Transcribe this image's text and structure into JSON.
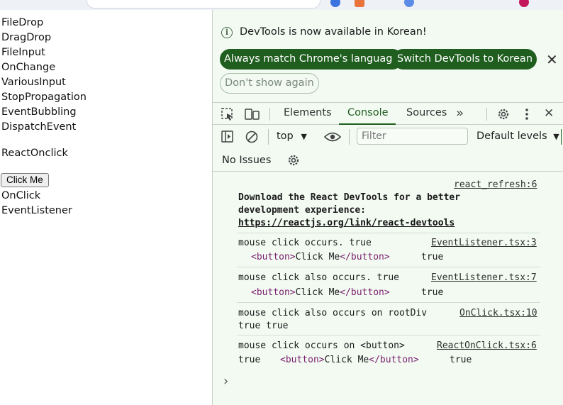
{
  "page": {
    "nav_links": [
      "FileDrop",
      "DragDrop",
      "FileInput",
      "OnChange",
      "VariousInput",
      "StopPropagation",
      "EventBubbling",
      "DispatchEvent"
    ],
    "section_title": "ReactOnclick",
    "button_label": "Click Me",
    "below_button": [
      "OnClick",
      "EventListener"
    ]
  },
  "devtools": {
    "banner": {
      "text": "DevTools is now available in Korean!",
      "always_match": "Always match Chrome's language",
      "switch_korean": "Switch DevTools to Korean",
      "dont_show": "Don't show again"
    },
    "tabs": [
      "Elements",
      "Console",
      "Sources"
    ],
    "active_tab": "Console",
    "context": "top",
    "filter_placeholder": "Filter",
    "levels": "Default levels",
    "issues": "No Issues",
    "console": {
      "refresh_src": "react_refresh:6",
      "download_line1": "Download the React DevTools for a better",
      "download_line2": "development experience:",
      "download_link": "https://reactjs.org/link/react-devtools",
      "entries": [
        {
          "msg": "mouse click occurs. true",
          "src": "EventListener.tsx:3",
          "tag_open": "<button>",
          "tag_text": "Click Me",
          "tag_close": "</button>",
          "tail": "true"
        },
        {
          "msg": "mouse click also occurs. true",
          "src": "EventListener.tsx:7",
          "tag_open": "<button>",
          "tag_text": "Click Me",
          "tag_close": "</button>",
          "tail": "true"
        },
        {
          "msg": "mouse click also occurs on rootDiv",
          "src": "OnClick.tsx:10",
          "second": "true true"
        },
        {
          "msg": "mouse click occurs on <button>",
          "src": "ReactOnClick.tsx:6",
          "lead": "true",
          "tag_open": "<button>",
          "tag_text": "Click Me",
          "tag_close": "</button>",
          "tail": "true"
        }
      ],
      "prompt": "›"
    }
  }
}
